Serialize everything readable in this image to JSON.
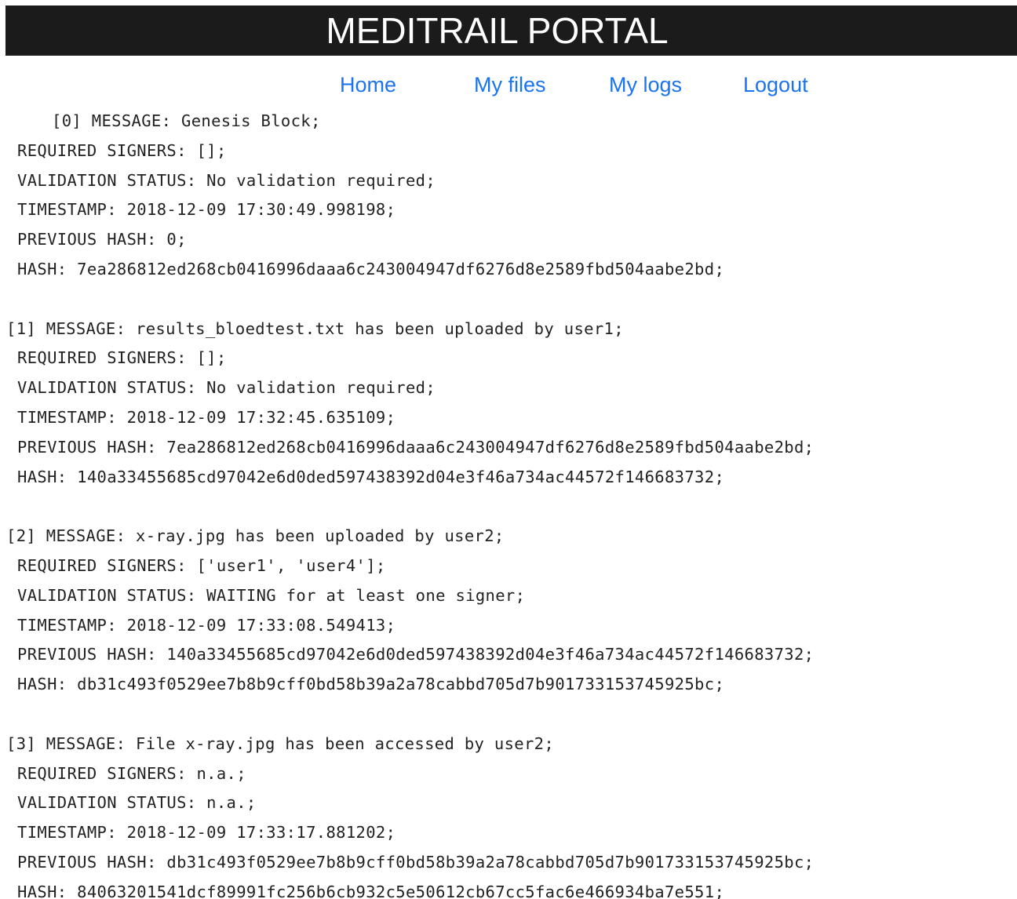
{
  "header": {
    "title": "MEDITRAIL PORTAL"
  },
  "nav": {
    "home": "Home",
    "my_files": "My files",
    "my_logs": "My logs",
    "logout": "Logout"
  },
  "blocks": [
    {
      "message": "[0] MESSAGE: Genesis Block;",
      "required_signers": "REQUIRED SIGNERS: [];",
      "validation_status": "VALIDATION STATUS: No validation required;",
      "timestamp": "TIMESTAMP: 2018-12-09 17:30:49.998198;",
      "previous_hash": "PREVIOUS HASH: 0;",
      "hash": "HASH: 7ea286812ed268cb0416996daaa6c243004947df6276d8e2589fbd504aabe2bd;"
    },
    {
      "message": "[1] MESSAGE: results_bloedtest.txt has been uploaded by user1;",
      "required_signers": "REQUIRED SIGNERS: [];",
      "validation_status": "VALIDATION STATUS: No validation required;",
      "timestamp": "TIMESTAMP: 2018-12-09 17:32:45.635109;",
      "previous_hash": "PREVIOUS HASH: 7ea286812ed268cb0416996daaa6c243004947df6276d8e2589fbd504aabe2bd;",
      "hash": "HASH: 140a33455685cd97042e6d0ded597438392d04e3f46a734ac44572f146683732;"
    },
    {
      "message": "[2] MESSAGE: x-ray.jpg has been uploaded by user2;",
      "required_signers": "REQUIRED SIGNERS: ['user1', 'user4'];",
      "validation_status": "VALIDATION STATUS: WAITING for at least one signer;",
      "timestamp": "TIMESTAMP: 2018-12-09 17:33:08.549413;",
      "previous_hash": "PREVIOUS HASH: 140a33455685cd97042e6d0ded597438392d04e3f46a734ac44572f146683732;",
      "hash": "HASH: db31c493f0529ee7b8b9cff0bd58b39a2a78cabbd705d7b901733153745925bc;"
    },
    {
      "message": "[3] MESSAGE: File x-ray.jpg has been accessed by user2;",
      "required_signers": "REQUIRED SIGNERS: n.a.;",
      "validation_status": "VALIDATION STATUS: n.a.;",
      "timestamp": "TIMESTAMP: 2018-12-09 17:33:17.881202;",
      "previous_hash": "PREVIOUS HASH: db31c493f0529ee7b8b9cff0bd58b39a2a78cabbd705d7b901733153745925bc;",
      "hash": "HASH: 84063201541dcf89991fc256b6cb932c5e50612cb67cc5fac6e466934ba7e551;"
    }
  ],
  "colors": {
    "header_bg": "#1b1b1b",
    "header_text": "#ffffff",
    "link": "#1a73f0",
    "body_text": "#222222"
  }
}
